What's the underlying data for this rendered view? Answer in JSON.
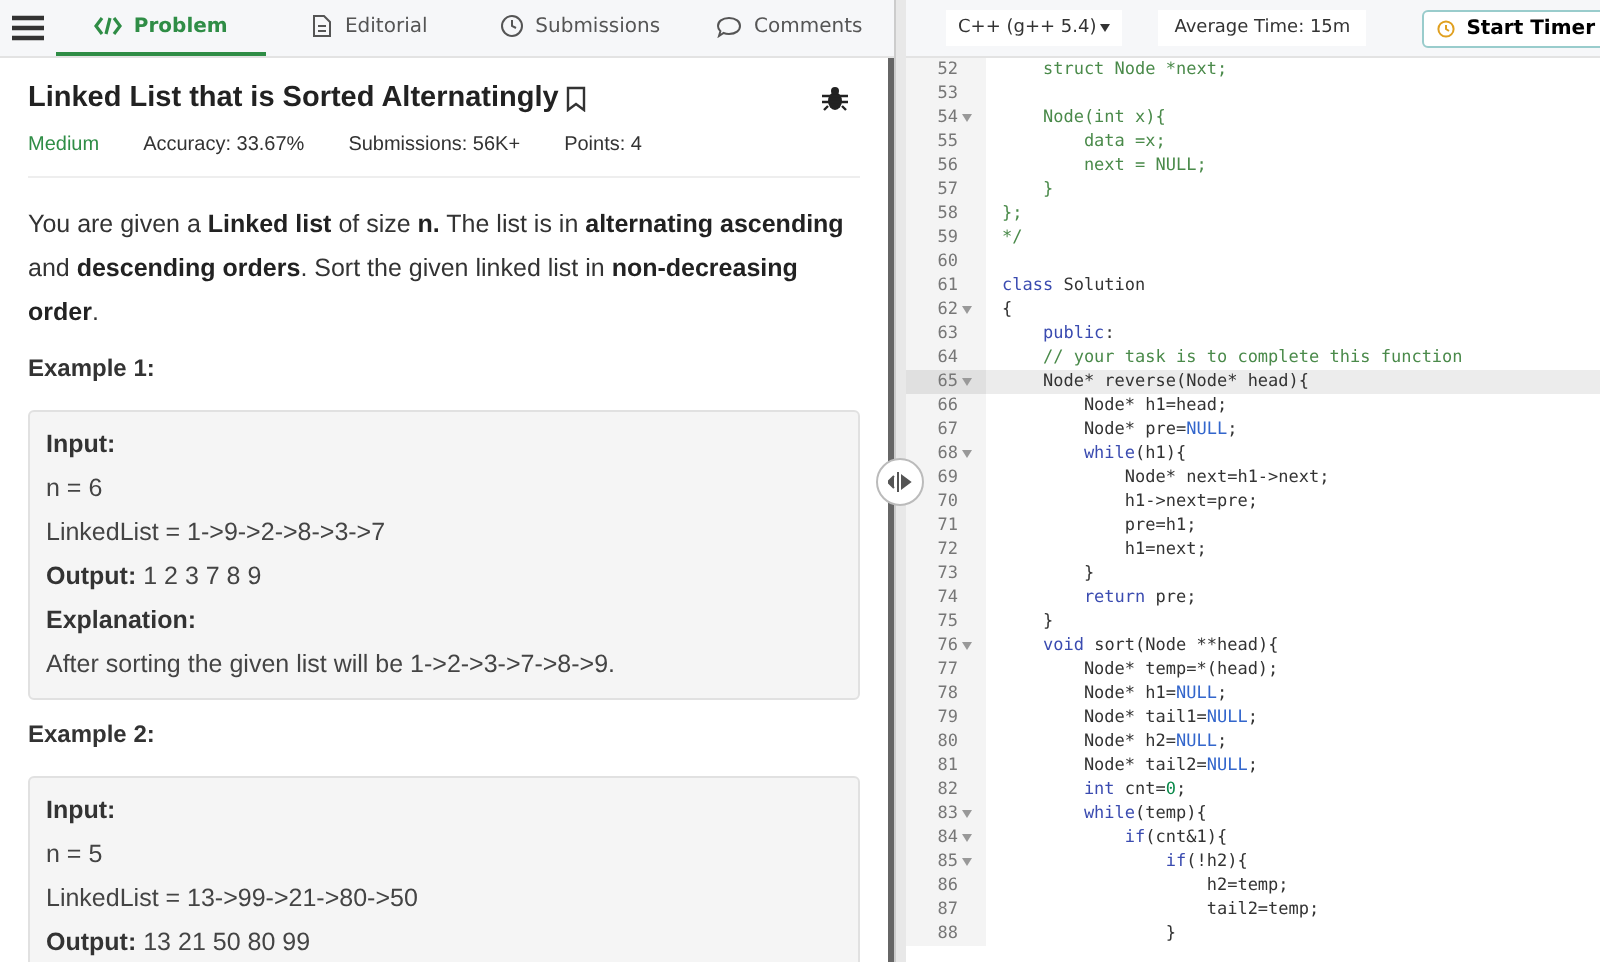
{
  "tabs": [
    {
      "label": "Problem",
      "selected": true
    },
    {
      "label": "Editorial",
      "selected": false
    },
    {
      "label": "Submissions",
      "selected": false
    },
    {
      "label": "Comments",
      "selected": false
    }
  ],
  "problem": {
    "title": "Linked List that is Sorted Alternatingly",
    "difficulty": "Medium",
    "accuracy": "Accuracy: 33.67%",
    "submissions": "Submissions: 56K+",
    "points": "Points: 4",
    "description": "You are given a **Linked list** of size **n.** The list is in **alternating ascending** and **descending orders**. Sort the given linked list in **non-decreasing order**.",
    "examples": [
      {
        "heading": "Example 1:",
        "lines": [
          {
            "label": "Input:"
          },
          {
            "value": "n = 6"
          },
          {
            "value": "LinkedList = 1->9->2->8->3->7"
          },
          {
            "label": "Output:",
            "value": "1 2 3 7 8 9"
          },
          {
            "label": "Explanation:"
          },
          {
            "value": "After sorting the given list will be 1->2->3->7->8->9."
          }
        ]
      },
      {
        "heading": "Example 2:",
        "lines": [
          {
            "label": "Input:"
          },
          {
            "value": "n = 5"
          },
          {
            "value": "LinkedList = 13->99->21->80->50"
          },
          {
            "label": "Output:",
            "value": "13 21 50 80 99"
          }
        ]
      }
    ]
  },
  "editor": {
    "language": "C++ (g++ 5.4)",
    "average_time": "Average Time: 15m",
    "timer_button": "Start Timer",
    "lines": [
      {
        "num": "52",
        "fold": false,
        "active": false,
        "parts": [
          {
            "kind": "comment",
            "text": "    struct Node *next;"
          }
        ]
      },
      {
        "num": "53",
        "fold": false,
        "active": false
      },
      {
        "num": "54",
        "fold": true,
        "active": false,
        "parts": [
          {
            "kind": "comment",
            "text": "    Node(int x){"
          }
        ]
      },
      {
        "num": "55",
        "fold": false,
        "active": false,
        "parts": [
          {
            "kind": "comment",
            "text": "        data =x;"
          }
        ]
      },
      {
        "num": "56",
        "fold": false,
        "active": false,
        "parts": [
          {
            "kind": "comment",
            "text": "        next = NULL;"
          }
        ]
      },
      {
        "num": "57",
        "fold": false,
        "active": false,
        "parts": [
          {
            "kind": "comment",
            "text": "    }"
          }
        ]
      },
      {
        "num": "58",
        "fold": false,
        "active": false,
        "parts": [
          {
            "kind": "comment",
            "text": "};"
          }
        ]
      },
      {
        "num": "59",
        "fold": false,
        "active": false,
        "parts": [
          {
            "kind": "comment",
            "text": "*/"
          }
        ]
      },
      {
        "num": "60",
        "fold": false,
        "active": false
      },
      {
        "num": "61",
        "fold": false,
        "active": false,
        "parts": [
          {
            "kind": "kw",
            "text": "class"
          },
          {
            "kind": "plain",
            "text": " Solution"
          }
        ]
      },
      {
        "num": "62",
        "fold": true,
        "active": false,
        "parts": [
          {
            "kind": "plain",
            "text": "{"
          }
        ]
      },
      {
        "num": "63",
        "fold": false,
        "active": false,
        "parts": [
          {
            "kind": "kw",
            "text": "    public"
          },
          {
            "kind": "plain",
            "text": ":"
          }
        ]
      },
      {
        "num": "64",
        "fold": false,
        "active": false,
        "parts": [
          {
            "kind": "comment",
            "text": "    // your task is to complete this function"
          }
        ]
      },
      {
        "num": "65",
        "fold": true,
        "active": true,
        "parts": [
          {
            "kind": "plain",
            "text": "    Node* reverse(Node* head){"
          }
        ]
      },
      {
        "num": "66",
        "fold": false,
        "active": false,
        "parts": [
          {
            "kind": "plain",
            "text": "        Node* h1=head;"
          }
        ]
      },
      {
        "num": "67",
        "fold": false,
        "active": false,
        "parts": [
          {
            "kind": "plain",
            "text": "        Node* pre="
          },
          {
            "kind": "const",
            "text": "NULL"
          },
          {
            "kind": "plain",
            "text": ";"
          }
        ]
      },
      {
        "num": "68",
        "fold": true,
        "active": false,
        "parts": [
          {
            "kind": "kw",
            "text": "        while"
          },
          {
            "kind": "plain",
            "text": "(h1){"
          }
        ]
      },
      {
        "num": "69",
        "fold": false,
        "active": false,
        "parts": [
          {
            "kind": "plain",
            "text": "            Node* next=h1->next;"
          }
        ]
      },
      {
        "num": "70",
        "fold": false,
        "active": false,
        "parts": [
          {
            "kind": "plain",
            "text": "            h1->next=pre;"
          }
        ]
      },
      {
        "num": "71",
        "fold": false,
        "active": false,
        "parts": [
          {
            "kind": "plain",
            "text": "            pre=h1;"
          }
        ]
      },
      {
        "num": "72",
        "fold": false,
        "active": false,
        "parts": [
          {
            "kind": "plain",
            "text": "            h1=next;"
          }
        ]
      },
      {
        "num": "73",
        "fold": false,
        "active": false,
        "parts": [
          {
            "kind": "plain",
            "text": "        }"
          }
        ]
      },
      {
        "num": "74",
        "fold": false,
        "active": false,
        "parts": [
          {
            "kind": "kw",
            "text": "        return"
          },
          {
            "kind": "plain",
            "text": " pre;"
          }
        ]
      },
      {
        "num": "75",
        "fold": false,
        "active": false,
        "parts": [
          {
            "kind": "plain",
            "text": "    }"
          }
        ]
      },
      {
        "num": "76",
        "fold": true,
        "active": false,
        "parts": [
          {
            "kind": "kw",
            "text": "    void"
          },
          {
            "kind": "plain",
            "text": " sort(Node **head){"
          }
        ]
      },
      {
        "num": "77",
        "fold": false,
        "active": false,
        "parts": [
          {
            "kind": "plain",
            "text": "        Node* temp=*(head);"
          }
        ]
      },
      {
        "num": "78",
        "fold": false,
        "active": false,
        "parts": [
          {
            "kind": "plain",
            "text": "        Node* h1="
          },
          {
            "kind": "const",
            "text": "NULL"
          },
          {
            "kind": "plain",
            "text": ";"
          }
        ]
      },
      {
        "num": "79",
        "fold": false,
        "active": false,
        "parts": [
          {
            "kind": "plain",
            "text": "        Node* tail1="
          },
          {
            "kind": "const",
            "text": "NULL"
          },
          {
            "kind": "plain",
            "text": ";"
          }
        ]
      },
      {
        "num": "80",
        "fold": false,
        "active": false,
        "parts": [
          {
            "kind": "plain",
            "text": "        Node* h2="
          },
          {
            "kind": "const",
            "text": "NULL"
          },
          {
            "kind": "plain",
            "text": ";"
          }
        ]
      },
      {
        "num": "81",
        "fold": false,
        "active": false,
        "parts": [
          {
            "kind": "plain",
            "text": "        Node* tail2="
          },
          {
            "kind": "const",
            "text": "NULL"
          },
          {
            "kind": "plain",
            "text": ";"
          }
        ]
      },
      {
        "num": "82",
        "fold": false,
        "active": false,
        "parts": [
          {
            "kind": "kw",
            "text": "        int"
          },
          {
            "kind": "plain",
            "text": " cnt="
          },
          {
            "kind": "num",
            "text": "0"
          },
          {
            "kind": "plain",
            "text": ";"
          }
        ]
      },
      {
        "num": "83",
        "fold": true,
        "active": false,
        "parts": [
          {
            "kind": "kw",
            "text": "        while"
          },
          {
            "kind": "plain",
            "text": "(temp){"
          }
        ]
      },
      {
        "num": "84",
        "fold": true,
        "active": false,
        "parts": [
          {
            "kind": "kw",
            "text": "            if"
          },
          {
            "kind": "plain",
            "text": "(cnt&1){"
          }
        ]
      },
      {
        "num": "85",
        "fold": true,
        "active": false,
        "parts": [
          {
            "kind": "kw",
            "text": "                if"
          },
          {
            "kind": "plain",
            "text": "(!h2){"
          }
        ]
      },
      {
        "num": "86",
        "fold": false,
        "active": false,
        "parts": [
          {
            "kind": "plain",
            "text": "                    h2=temp;"
          }
        ]
      },
      {
        "num": "87",
        "fold": false,
        "active": false,
        "parts": [
          {
            "kind": "plain",
            "text": "                    tail2=temp;"
          }
        ]
      },
      {
        "num": "88",
        "fold": false,
        "active": false,
        "parts": [
          {
            "kind": "plain",
            "text": "                }"
          }
        ]
      }
    ]
  }
}
